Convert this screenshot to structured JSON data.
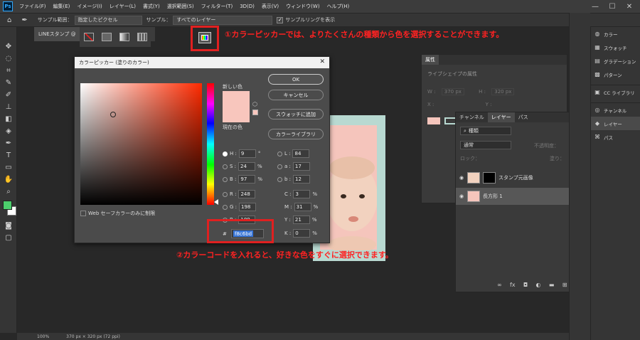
{
  "app": {
    "logo": "Ps",
    "menu": [
      "ファイル(F)",
      "編集(E)",
      "イメージ(I)",
      "レイヤー(L)",
      "書式(Y)",
      "選択範囲(S)",
      "フィルター(T)",
      "3D(D)",
      "表示(V)",
      "ウィンドウ(W)",
      "ヘルプ(H)"
    ],
    "window_controls": [
      "—",
      "☐",
      "✕"
    ]
  },
  "options": {
    "sample_range_label": "サンプル範囲：",
    "sample_range_value": "指定したピクセル",
    "sample_label": "サンプル：",
    "sample_value": "すべてのレイヤー",
    "show_ring_label": "サンプルリングを表示",
    "show_ring_checked": true
  },
  "document": {
    "tab": "LINEスタンプ @",
    "zoom": "100%",
    "size_info": "370 px × 320 px (72 ppi)"
  },
  "color_picker": {
    "title": "カラーピッカー (塗りのカラー)",
    "new_label": "新しい色",
    "current_label": "現在の色",
    "new_color": "#f8c6bd",
    "current_color": "#f8c6bd",
    "buttons": {
      "ok": "OK",
      "cancel": "キャンセル",
      "add_swatch": "スウォッチに追加",
      "libraries": "カラーライブラリ"
    },
    "web_only_label": "Web セーフカラーのみに制限",
    "hsb": {
      "h": "9",
      "s": "24",
      "b": "97"
    },
    "rgb": {
      "r": "248",
      "g": "198",
      "b": "189"
    },
    "lab": {
      "l": "84",
      "a": "17",
      "b": "12"
    },
    "cmyk": {
      "c": "3",
      "m": "31",
      "y": "21",
      "k": "0"
    },
    "labels": {
      "h": "H :",
      "s": "S :",
      "b": "B :",
      "r": "R :",
      "g": "G :",
      "bb": "B :",
      "l": "L :",
      "a": "a :",
      "lb": "b :",
      "c": "C :",
      "m": "M :",
      "y": "Y :",
      "k": "K :"
    },
    "units": {
      "deg": "°",
      "pct": "%"
    },
    "hex_label": "#",
    "hex": "f8c6bd"
  },
  "annotations": {
    "first": "①カラーピッカーでは、よりたくさんの種類から色を選択することができます。",
    "second": "②カラーコードを入れると、好きな色をすぐに選択できます。"
  },
  "properties": {
    "tab": "属性",
    "subtitle": "ライブシェイプの属性",
    "w_label": "W :",
    "w_value": "370 px",
    "h_label": "H :",
    "h_value": "320 px",
    "x_label": "X :",
    "y_label": "Y :"
  },
  "layers_panel": {
    "tabs": [
      "チャンネル",
      "レイヤー",
      "パス"
    ],
    "filter_label": "種類",
    "blend_mode": "通常",
    "opacity_label": "不透明度：",
    "lock_label": "ロック：",
    "fill_label": "塗り：",
    "layers": [
      {
        "name": "スタンプ元画像",
        "selected": false
      },
      {
        "name": "長方形 1",
        "selected": true
      }
    ],
    "footer_icons": [
      "link-icon",
      "fx-icon",
      "mask-icon",
      "adjustment-icon",
      "folder-icon",
      "new-layer-icon",
      "trash-icon"
    ]
  },
  "right_panel": {
    "groups": [
      [
        "カラー",
        "スウォッチ",
        "グラデーション",
        "パターン"
      ],
      [
        "CC ライブラリ"
      ],
      [
        "チャンネル",
        "レイヤー",
        "パス"
      ]
    ]
  },
  "colors": {
    "accent_red": "#e02020",
    "fg_color": "#4ccd6c",
    "bg_color": "#ffffff",
    "canvas_frame": "#b8d9d1",
    "canvas_fill": "#f5c5bc"
  }
}
